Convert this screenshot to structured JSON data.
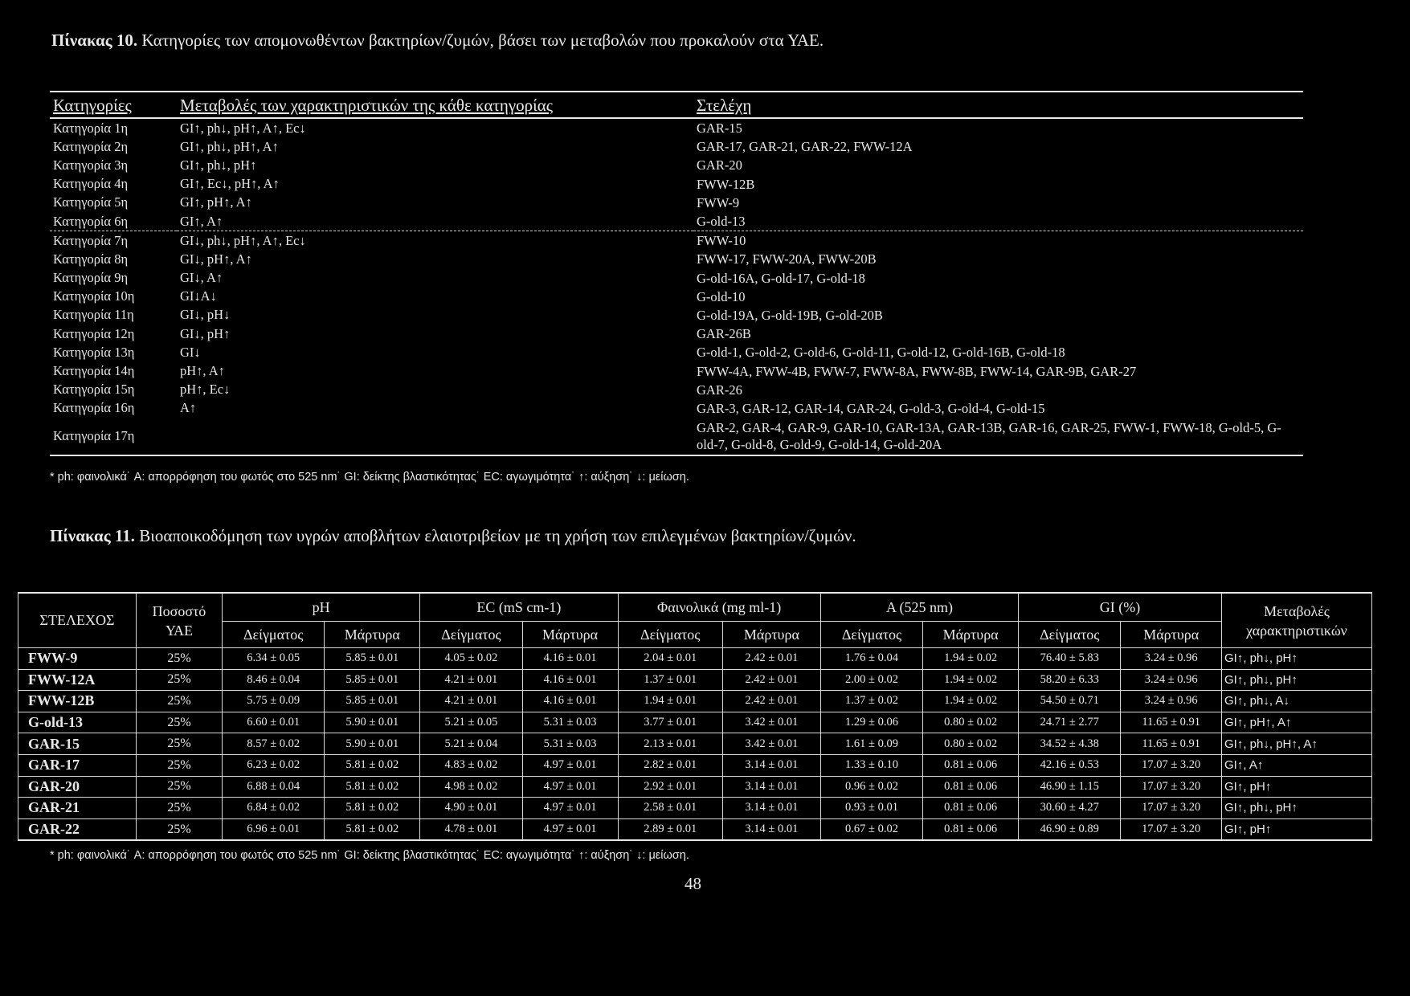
{
  "table10": {
    "caption_label": "Πίνακας 10.",
    "caption_text": "Κατηγορίες των απομονωθέντων βακτηρίων/ζυμών, βάσει των μεταβολών που προκαλούν στα ΥΑΕ.",
    "headers": [
      "Κατηγορίες",
      "Μεταβολές των χαρακτηριστικών της κάθε κατηγορίας",
      "Στελέχη"
    ],
    "rows": [
      {
        "cat": "Κατηγορία 1η",
        "changes": "GI↑, ph↓, pH↑, A↑, Ec↓",
        "strains": "GAR-15"
      },
      {
        "cat": "Κατηγορία 2η",
        "changes": "GI↑, ph↓, pH↑, A↑",
        "strains": "GAR-17, GAR-21, GAR-22, FWW-12A"
      },
      {
        "cat": "Κατηγορία 3η",
        "changes": "GI↑, ph↓, pH↑",
        "strains": "GAR-20"
      },
      {
        "cat": "Κατηγορία 4η",
        "changes": "GI↑, Ec↓, pH↑, A↑",
        "strains": "FWW-12B"
      },
      {
        "cat": "Κατηγορία 5η",
        "changes": "GI↑, pH↑, A↑",
        "strains": "FWW-9"
      },
      {
        "cat": "Κατηγορία 6η",
        "changes": "GI↑, A↑",
        "strains": "G-old-13"
      },
      {
        "cat": "Κατηγορία 7η",
        "changes": "GI↓, ph↓, pH↑, A↑, Ec↓",
        "strains": "FWW-10"
      },
      {
        "cat": "Κατηγορία 8η",
        "changes": "GI↓, pH↑, A↑",
        "strains": "FWW-17, FWW-20A, FWW-20B"
      },
      {
        "cat": "Κατηγορία 9η",
        "changes": "GI↓, A↑",
        "strains": "G-old-16A, G-old-17, G-old-18"
      },
      {
        "cat": "Κατηγορία 10η",
        "changes": "GI↓A↓",
        "strains": "G-old-10"
      },
      {
        "cat": "Κατηγορία 11η",
        "changes": "GI↓, pH↓",
        "strains": "G-old-19A, G-old-19B, G-old-20B"
      },
      {
        "cat": "Κατηγορία 12η",
        "changes": "GI↓, pH↑",
        "strains": "GAR-26B"
      },
      {
        "cat": "Κατηγορία 13η",
        "changes": "GI↓",
        "strains": "G-old-1, G-old-2, G-old-6, G-old-11, G-old-12, G-old-16B, G-old-18"
      },
      {
        "cat": "Κατηγορία 14η",
        "changes": "pH↑, A↑",
        "strains": "FWW-4A, FWW-4B, FWW-7, FWW-8A, FWW-8B, FWW-14, GAR-9B, GAR-27"
      },
      {
        "cat": "Κατηγορία 15η",
        "changes": "pH↑, Ec↓",
        "strains": "GAR-26"
      },
      {
        "cat": "Κατηγορία 16η",
        "changes": "A↑",
        "strains": "GAR-3, GAR-12, GAR-14, GAR-24, G-old-3, G-old-4, G-old-15"
      },
      {
        "cat": "Κατηγορία 17η",
        "changes": "",
        "strains": "GAR-2, GAR-4, GAR-9, GAR-10, GAR-13A, GAR-13B, GAR-16, GAR-25, FWW-1, FWW-18, G-old-5, G-old-7, G-old-8, G-old-9, G-old-14, G-old-20A"
      }
    ],
    "note": "* ph: φαινολικά˙ A: απορρόφηση του φωτός στο 525 nm˙ GI: δείκτης βλαστικότητας˙ EC: αγωγιμότητα˙ ↑: αύξηση˙ ↓: μείωση."
  },
  "table11": {
    "caption_label": "Πίνακας 11.",
    "caption_text": "Βιοαποικοδόμηση των υγρών αποβλήτων ελαιοτριβείων με τη χρήση των επιλεγμένων βακτηρίων/ζυμών.",
    "header": {
      "strain": "ΣΤΕΛΕΧΟΣ",
      "percent": "Ποσοστό ΥΑΕ",
      "ph": "pH",
      "ec": "EC (mS cm-1)",
      "phenolics": "Φαινολικά (mg ml-1)",
      "absorbance": "A (525 nm)",
      "gi": "GI (%)",
      "changes": "Μεταβολές χαρακτηριστικών",
      "sample": "Δείγματος",
      "control": "Μάρτυρα"
    },
    "rows": [
      {
        "strain": "FWW-9",
        "pct": "25%",
        "ph_s": "6.34 ± 0.05",
        "ph_c": "5.85 ± 0.01",
        "ec_s": "4.05 ± 0.02",
        "ec_c": "4.16 ± 0.01",
        "phen_s": "2.04 ± 0.01",
        "phen_c": "2.42 ± 0.01",
        "a_s": "1.76 ± 0.04",
        "a_c": "1.94 ± 0.02",
        "gi_s": "76.40 ± 5.83",
        "gi_c": "3.24 ± 0.96",
        "chg": "GI↑, ph↓, pH↑"
      },
      {
        "strain": "FWW-12A",
        "pct": "25%",
        "ph_s": "8.46 ± 0.04",
        "ph_c": "5.85 ± 0.01",
        "ec_s": "4.21 ± 0.01",
        "ec_c": "4.16 ± 0.01",
        "phen_s": "1.37 ± 0.01",
        "phen_c": "2.42 ± 0.01",
        "a_s": "2.00 ± 0.02",
        "a_c": "1.94 ± 0.02",
        "gi_s": "58.20 ± 6.33",
        "gi_c": "3.24 ± 0.96",
        "chg": "GI↑, ph↓, pH↑"
      },
      {
        "strain": "FWW-12B",
        "pct": "25%",
        "ph_s": "5.75 ± 0.09",
        "ph_c": "5.85 ± 0.01",
        "ec_s": "4.21 ± 0.01",
        "ec_c": "4.16 ± 0.01",
        "phen_s": "1.94 ± 0.01",
        "phen_c": "2.42 ± 0.01",
        "a_s": "1.37 ± 0.02",
        "a_c": "1.94 ± 0.02",
        "gi_s": "54.50 ± 0.71",
        "gi_c": "3.24 ± 0.96",
        "chg": "GI↑, ph↓, A↓"
      },
      {
        "strain": "G-old-13",
        "pct": "25%",
        "ph_s": "6.60 ± 0.01",
        "ph_c": "5.90 ± 0.01",
        "ec_s": "5.21 ± 0.05",
        "ec_c": "5.31 ± 0.03",
        "phen_s": "3.77 ± 0.01",
        "phen_c": "3.42 ± 0.01",
        "a_s": "1.29 ± 0.06",
        "a_c": "0.80 ± 0.02",
        "gi_s": "24.71 ± 2.77",
        "gi_c": "11.65 ± 0.91",
        "chg": "GI↑, pH↑, A↑"
      },
      {
        "strain": "GAR-15",
        "pct": "25%",
        "ph_s": "8.57 ± 0.02",
        "ph_c": "5.90 ± 0.01",
        "ec_s": "5.21 ± 0.04",
        "ec_c": "5.31 ± 0.03",
        "phen_s": "2.13 ± 0.01",
        "phen_c": "3.42 ± 0.01",
        "a_s": "1.61 ± 0.09",
        "a_c": "0.80 ± 0.02",
        "gi_s": "34.52 ± 4.38",
        "gi_c": "11.65 ± 0.91",
        "chg": "GI↑, ph↓, pH↑, A↑"
      },
      {
        "strain": "GAR-17",
        "pct": "25%",
        "ph_s": "6.23 ± 0.02",
        "ph_c": "5.81 ± 0.02",
        "ec_s": "4.83 ± 0.02",
        "ec_c": "4.97 ± 0.01",
        "phen_s": "2.82 ± 0.01",
        "phen_c": "3.14 ± 0.01",
        "a_s": "1.33 ± 0.10",
        "a_c": "0.81 ± 0.06",
        "gi_s": "42.16 ± 0.53",
        "gi_c": "17.07 ± 3.20",
        "chg": "GI↑, A↑"
      },
      {
        "strain": "GAR-20",
        "pct": "25%",
        "ph_s": "6.88 ± 0.04",
        "ph_c": "5.81 ± 0.02",
        "ec_s": "4.98 ± 0.02",
        "ec_c": "4.97 ± 0.01",
        "phen_s": "2.92 ± 0.01",
        "phen_c": "3.14 ± 0.01",
        "a_s": "0.96 ± 0.02",
        "a_c": "0.81 ± 0.06",
        "gi_s": "46.90 ± 1.15",
        "gi_c": "17.07 ± 3.20",
        "chg": "GI↑, pH↑"
      },
      {
        "strain": "GAR-21",
        "pct": "25%",
        "ph_s": "6.84 ± 0.02",
        "ph_c": "5.81 ± 0.02",
        "ec_s": "4.90 ± 0.01",
        "ec_c": "4.97 ± 0.01",
        "phen_s": "2.58 ± 0.01",
        "phen_c": "3.14 ± 0.01",
        "a_s": "0.93 ± 0.01",
        "a_c": "0.81 ± 0.06",
        "gi_s": "30.60 ± 4.27",
        "gi_c": "17.07 ± 3.20",
        "chg": "GI↑, ph↓, pH↑"
      },
      {
        "strain": "GAR-22",
        "pct": "25%",
        "ph_s": "6.96 ± 0.01",
        "ph_c": "5.81 ± 0.02",
        "ec_s": "4.78 ± 0.01",
        "ec_c": "4.97 ± 0.01",
        "phen_s": "2.89 ± 0.01",
        "phen_c": "3.14 ± 0.01",
        "a_s": "0.67 ± 0.02",
        "a_c": "0.81 ± 0.06",
        "gi_s": "46.90 ± 0.89",
        "gi_c": "17.07 ± 3.20",
        "chg": "GI↑, pH↑"
      }
    ],
    "note": "* ph: φαινολικά˙ A: απορρόφηση του φωτός στο 525 nm˙ GI: δείκτης βλαστικότητας˙ EC: αγωγιμότητα˙ ↑: αύξηση˙ ↓: μείωση."
  },
  "page_number": "48"
}
